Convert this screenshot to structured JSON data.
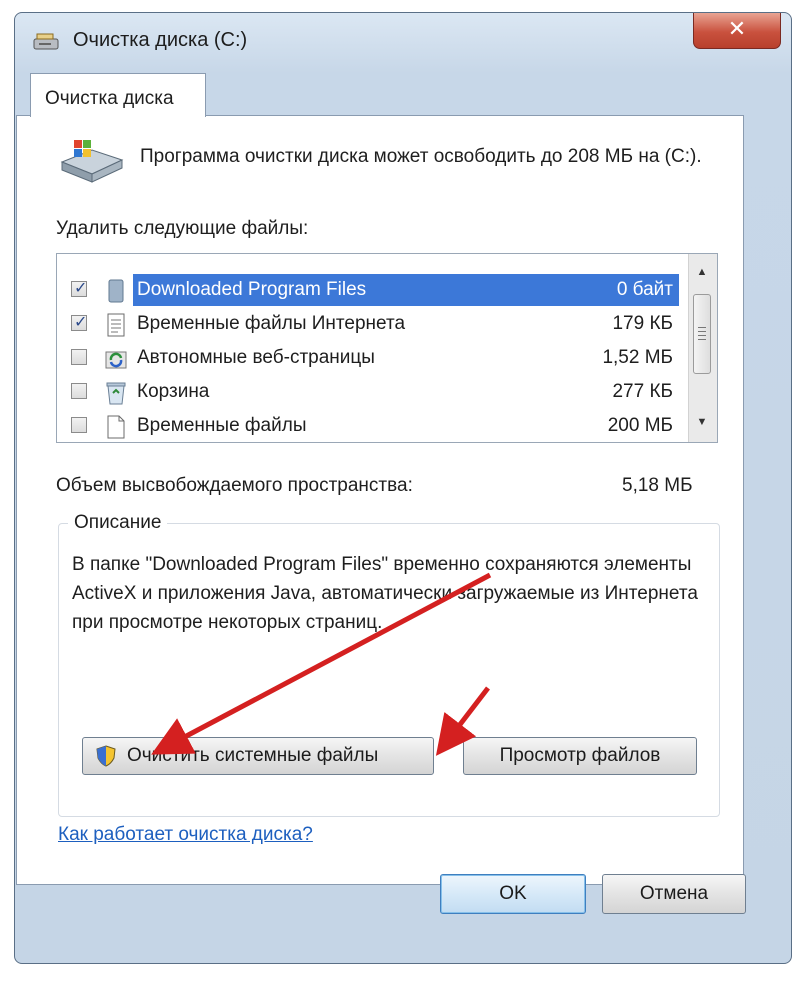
{
  "window": {
    "title": "Очистка диска  (C:)",
    "close_glyph": "✕"
  },
  "tab": {
    "label": "Очистка диска"
  },
  "info": {
    "text": "Программа очистки диска может освободить до 208 МБ на  (C:)."
  },
  "file_list": {
    "label": "Удалить следующие файлы:",
    "rows": [
      {
        "name": "Downloaded Program Files",
        "size": "0 байт",
        "checked": true,
        "selected": true,
        "icon": "folder-icon"
      },
      {
        "name": "Временные файлы Интернета",
        "size": "179 КБ",
        "checked": true,
        "selected": false,
        "icon": "document-icon"
      },
      {
        "name": "Автономные веб-страницы",
        "size": "1,52 МБ",
        "checked": false,
        "selected": false,
        "icon": "sync-icon"
      },
      {
        "name": "Корзина",
        "size": "277 КБ",
        "checked": false,
        "selected": false,
        "icon": "recycle-bin-icon"
      },
      {
        "name": "Временные файлы",
        "size": "200 МБ",
        "checked": false,
        "selected": false,
        "icon": "blank-file-icon"
      }
    ]
  },
  "freed": {
    "label": "Объем высвобождаемого пространства:",
    "value": "5,18 МБ"
  },
  "description": {
    "title": "Описание",
    "text": "В папке \"Downloaded Program Files\" временно сохраняются элементы ActiveX и приложения Java, автоматически загружаемые из Интернета при просмотре некоторых страниц."
  },
  "buttons": {
    "clean_system": "Очистить системные файлы",
    "view_files": "Просмотр файлов",
    "ok": "OK",
    "cancel": "Отмена"
  },
  "help_link": "Как работает очистка диска?",
  "colors": {
    "selection": "#3c78d8",
    "annotation_arrow": "#d42020",
    "link": "#1d5fbf"
  }
}
